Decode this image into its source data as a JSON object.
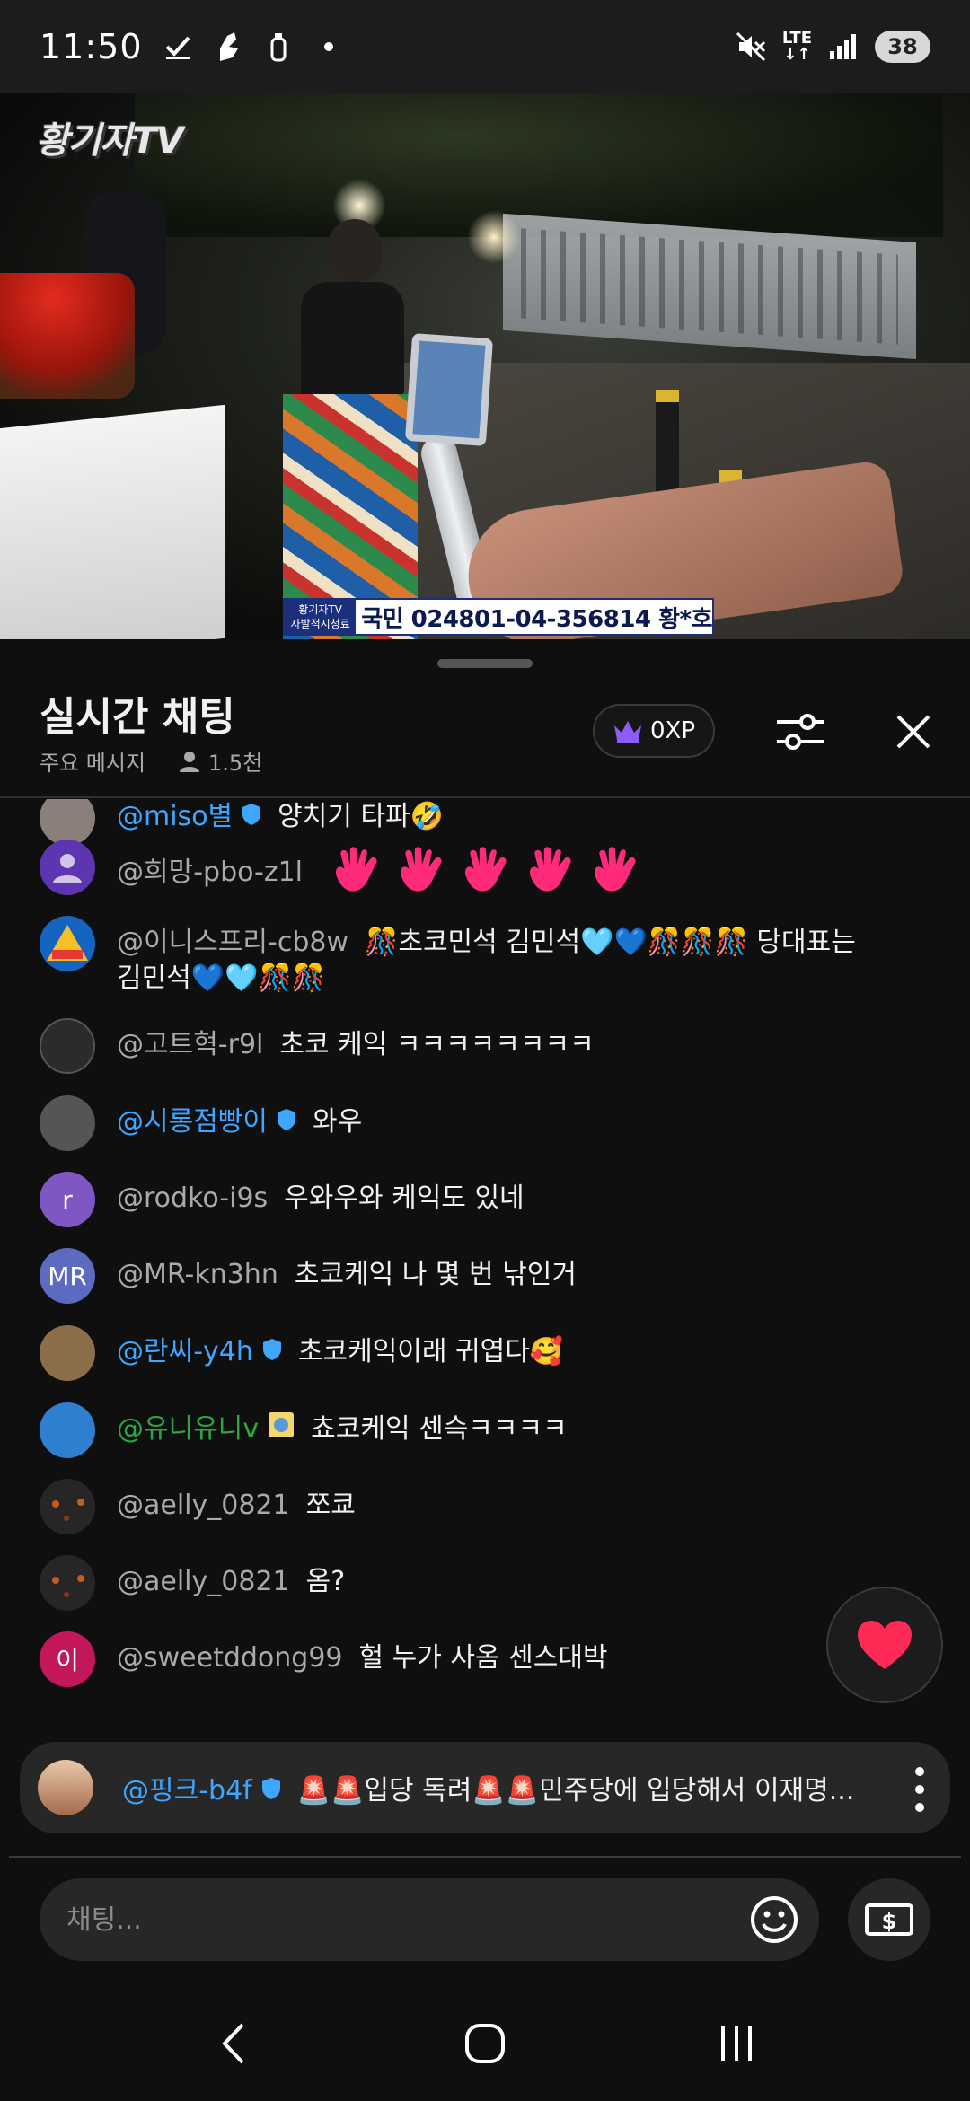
{
  "status_bar": {
    "time": "11:50",
    "network": "LTE",
    "battery": "38",
    "icons_left": [
      "check-icon",
      "gesture-icon",
      "usb-icon",
      "dot-icon"
    ],
    "icons_right": [
      "mute-icon",
      "lte-icon",
      "signal-icon",
      "battery-icon"
    ]
  },
  "video": {
    "channel_logo": "황기자TV",
    "banner_small_line1": "황기자TV",
    "banner_small_line2": "자발적시청료",
    "banner_account": "국민 024801-04-356814 황*호"
  },
  "chat": {
    "title": "실시간 채팅",
    "mode": "주요 메시지",
    "viewer_count": "1.5천",
    "xp": "0XP",
    "messages": [
      {
        "author": "@miso별",
        "member": true,
        "text": "양치기 타파🤣",
        "avatar_color": "#8a7f7a"
      },
      {
        "author": "@희망-pbo-z1l",
        "member": false,
        "text": "",
        "emoji_hands": 5,
        "avatar_color": "#5e35b1"
      },
      {
        "author": "@이니스프리-cb8w",
        "member": false,
        "text": "🎊초코민석 김민석🩵💙🎊🎊🎊 당대표는",
        "text2": "김민석💙🩵🎊🎊",
        "avatar_color": "#1565c0"
      },
      {
        "author": "@고트혁-r9l",
        "member": false,
        "text": "초코 케익 ㅋㅋㅋㅋㅋㅋㅋㅋ",
        "avatar_color": "#2b2b2b"
      },
      {
        "author": "@시롱점빵이",
        "member": true,
        "text": "와우",
        "avatar_color": "#555555"
      },
      {
        "author": "@rodko-i9s",
        "member": false,
        "text": "우와우와 케익도 있네",
        "avatar_letter": "r",
        "avatar_color": "#7e57c2"
      },
      {
        "author": "@MR-kn3hn",
        "member": false,
        "text": "초코케익 나 몇 번 낚인거",
        "avatar_letter": "MR",
        "avatar_color": "#5c6bc0"
      },
      {
        "author": "@란씨-y4h",
        "member": true,
        "text": "초코케익이래 귀엽다🥰",
        "avatar_color": "#8d6e4a"
      },
      {
        "author": "@유니유니v",
        "member": false,
        "green": true,
        "text": "쵸코케익 센슥ㅋㅋㅋㅋ",
        "avatar_color": "#2f7fd0"
      },
      {
        "author": "@aelly_0821",
        "member": false,
        "text": "쪼쿄",
        "avatar_color": "#262626"
      },
      {
        "author": "@aelly_0821",
        "member": false,
        "text": "옴?",
        "avatar_color": "#262626"
      },
      {
        "author": "@sweetddong99",
        "member": false,
        "text": "헐 누가 사옴 센스대박",
        "avatar_letter": "이",
        "avatar_color": "#c2185b"
      }
    ],
    "pinned": {
      "author": "@핑크-b4f",
      "text": "🚨🚨입당 독려🚨🚨민주당에 입당해서 이재명..."
    },
    "input_placeholder": "채팅...",
    "colors": {
      "member_blue": "#3ea6ff",
      "heart_red": "#ff2a55",
      "background": "#0f0f0f"
    }
  }
}
